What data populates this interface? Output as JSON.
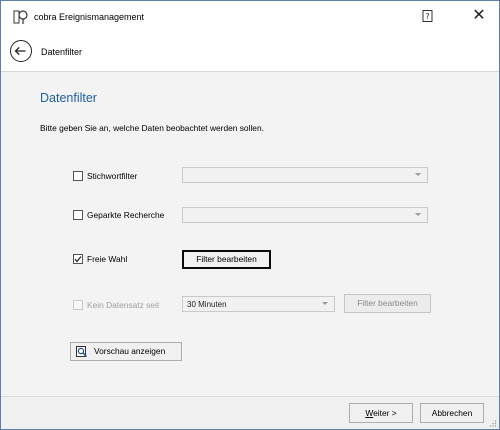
{
  "window": {
    "title": "cobra Ereignismanagement",
    "help_icon": "help-icon",
    "close_icon": "close-icon",
    "close_glyph": "✕"
  },
  "nav": {
    "back_icon": "back-arrow-icon",
    "title": "Datenfilter"
  },
  "page": {
    "heading": "Datenfilter",
    "instruction": "Bitte geben Sie an, welche Daten beobachtet werden sollen.",
    "heading_color": "#1f5fa8"
  },
  "filters": {
    "stichwort": {
      "label": "Stichwortfilter",
      "checked": false,
      "combo_value": ""
    },
    "recherche": {
      "label": "Geparkte Recherche",
      "checked": false,
      "combo_value": ""
    },
    "freie_wahl": {
      "label": "Freie Wahl",
      "checked": true,
      "button_label": "Filter bearbeiten"
    },
    "kein_datensatz": {
      "label": "Kein Datensatz seit",
      "checked": false,
      "disabled": true,
      "combo_value": "30 Minuten",
      "button_label": "Filter bearbeiten"
    }
  },
  "preview": {
    "label": "Vorschau anzeigen",
    "icon": "magnifier-preview-icon"
  },
  "footer": {
    "next_label_mnemonic": "W",
    "next_label_rest": "eiter >",
    "cancel_label": "Abbrechen"
  }
}
